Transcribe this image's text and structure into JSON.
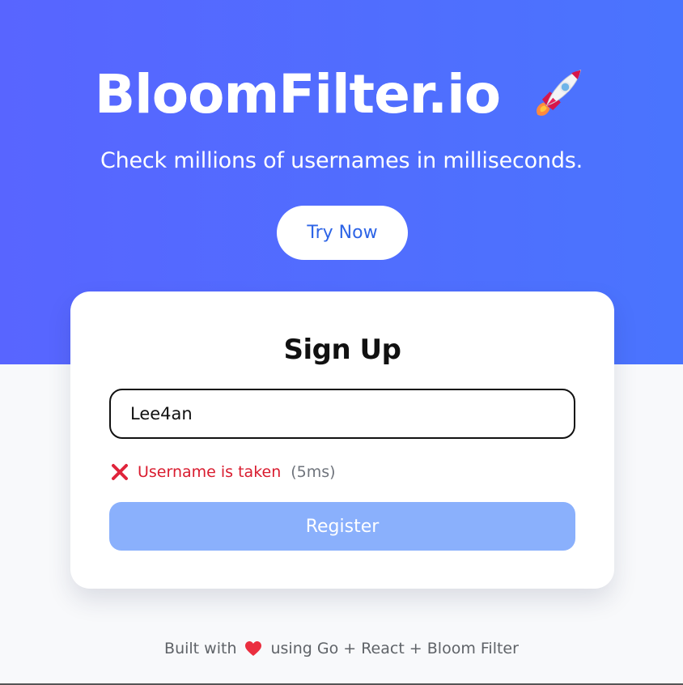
{
  "hero": {
    "title": "BloomFilter.io",
    "tagline": "Check millions of usernames in milliseconds.",
    "cta_label": "Try Now",
    "icon": "rocket-icon"
  },
  "signup": {
    "title": "Sign Up",
    "username_value": "Lee4an",
    "status": {
      "icon": "x-icon",
      "message": "Username is taken",
      "time": "(5ms)"
    },
    "register_label": "Register"
  },
  "footer": {
    "prefix": "Built with",
    "icon": "heart-icon",
    "suffix": "using Go + React + Bloom Filter"
  },
  "colors": {
    "hero_start": "#5865ff",
    "hero_end": "#4a74fe",
    "cta_text": "#2d64e6",
    "error": "#d91c2f",
    "register_disabled": "#8ab0fc"
  }
}
